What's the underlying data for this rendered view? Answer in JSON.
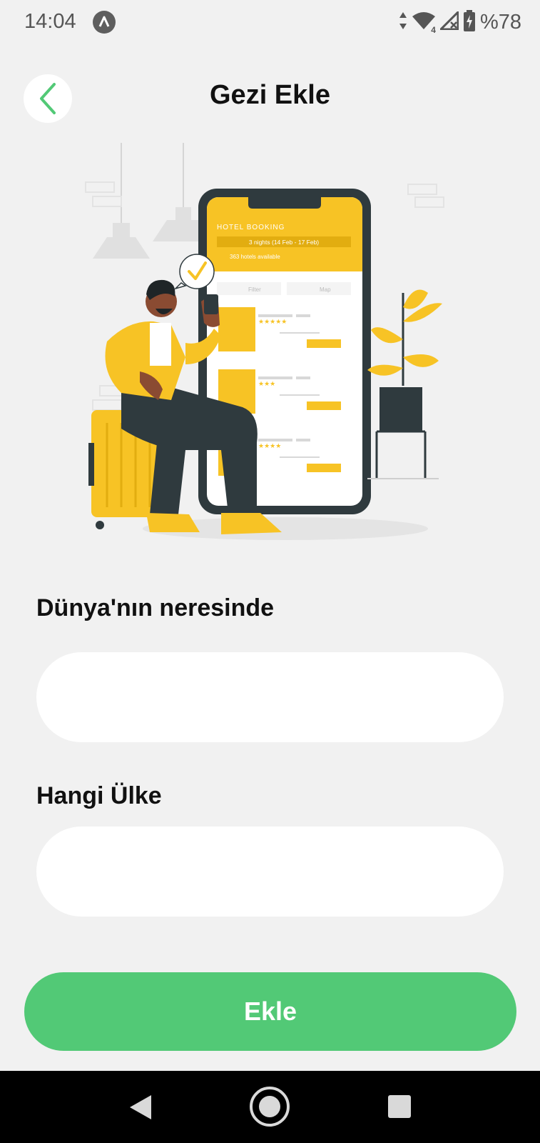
{
  "status_bar": {
    "time": "14:04",
    "battery": "%78",
    "network_badge": "4",
    "icons": [
      "app-notification-icon",
      "data-arrows-icon",
      "wifi-icon",
      "signal-icon",
      "battery-charging-icon"
    ]
  },
  "header": {
    "title": "Gezi Ekle",
    "back_icon": "chevron-left-icon"
  },
  "illustration": {
    "screen_header": "HOTEL BOOKING",
    "dates": "3 nights (14 Feb - 17 Feb)",
    "results": "363 hotels available",
    "filter": "Filter",
    "map": "Map"
  },
  "form": {
    "location_label": "Dünya'nın neresinde",
    "location_value": "",
    "country_label": "Hangi Ülke",
    "country_value": ""
  },
  "submit": {
    "label": "Ekle"
  },
  "nav_bar": {
    "icons": [
      "back-triangle-icon",
      "home-circle-icon",
      "recents-square-icon"
    ]
  },
  "colors": {
    "background": "#f1f1f1",
    "accent_green": "#52c976",
    "illustration_yellow": "#f7c325",
    "illustration_dark": "#2f3a3e"
  }
}
